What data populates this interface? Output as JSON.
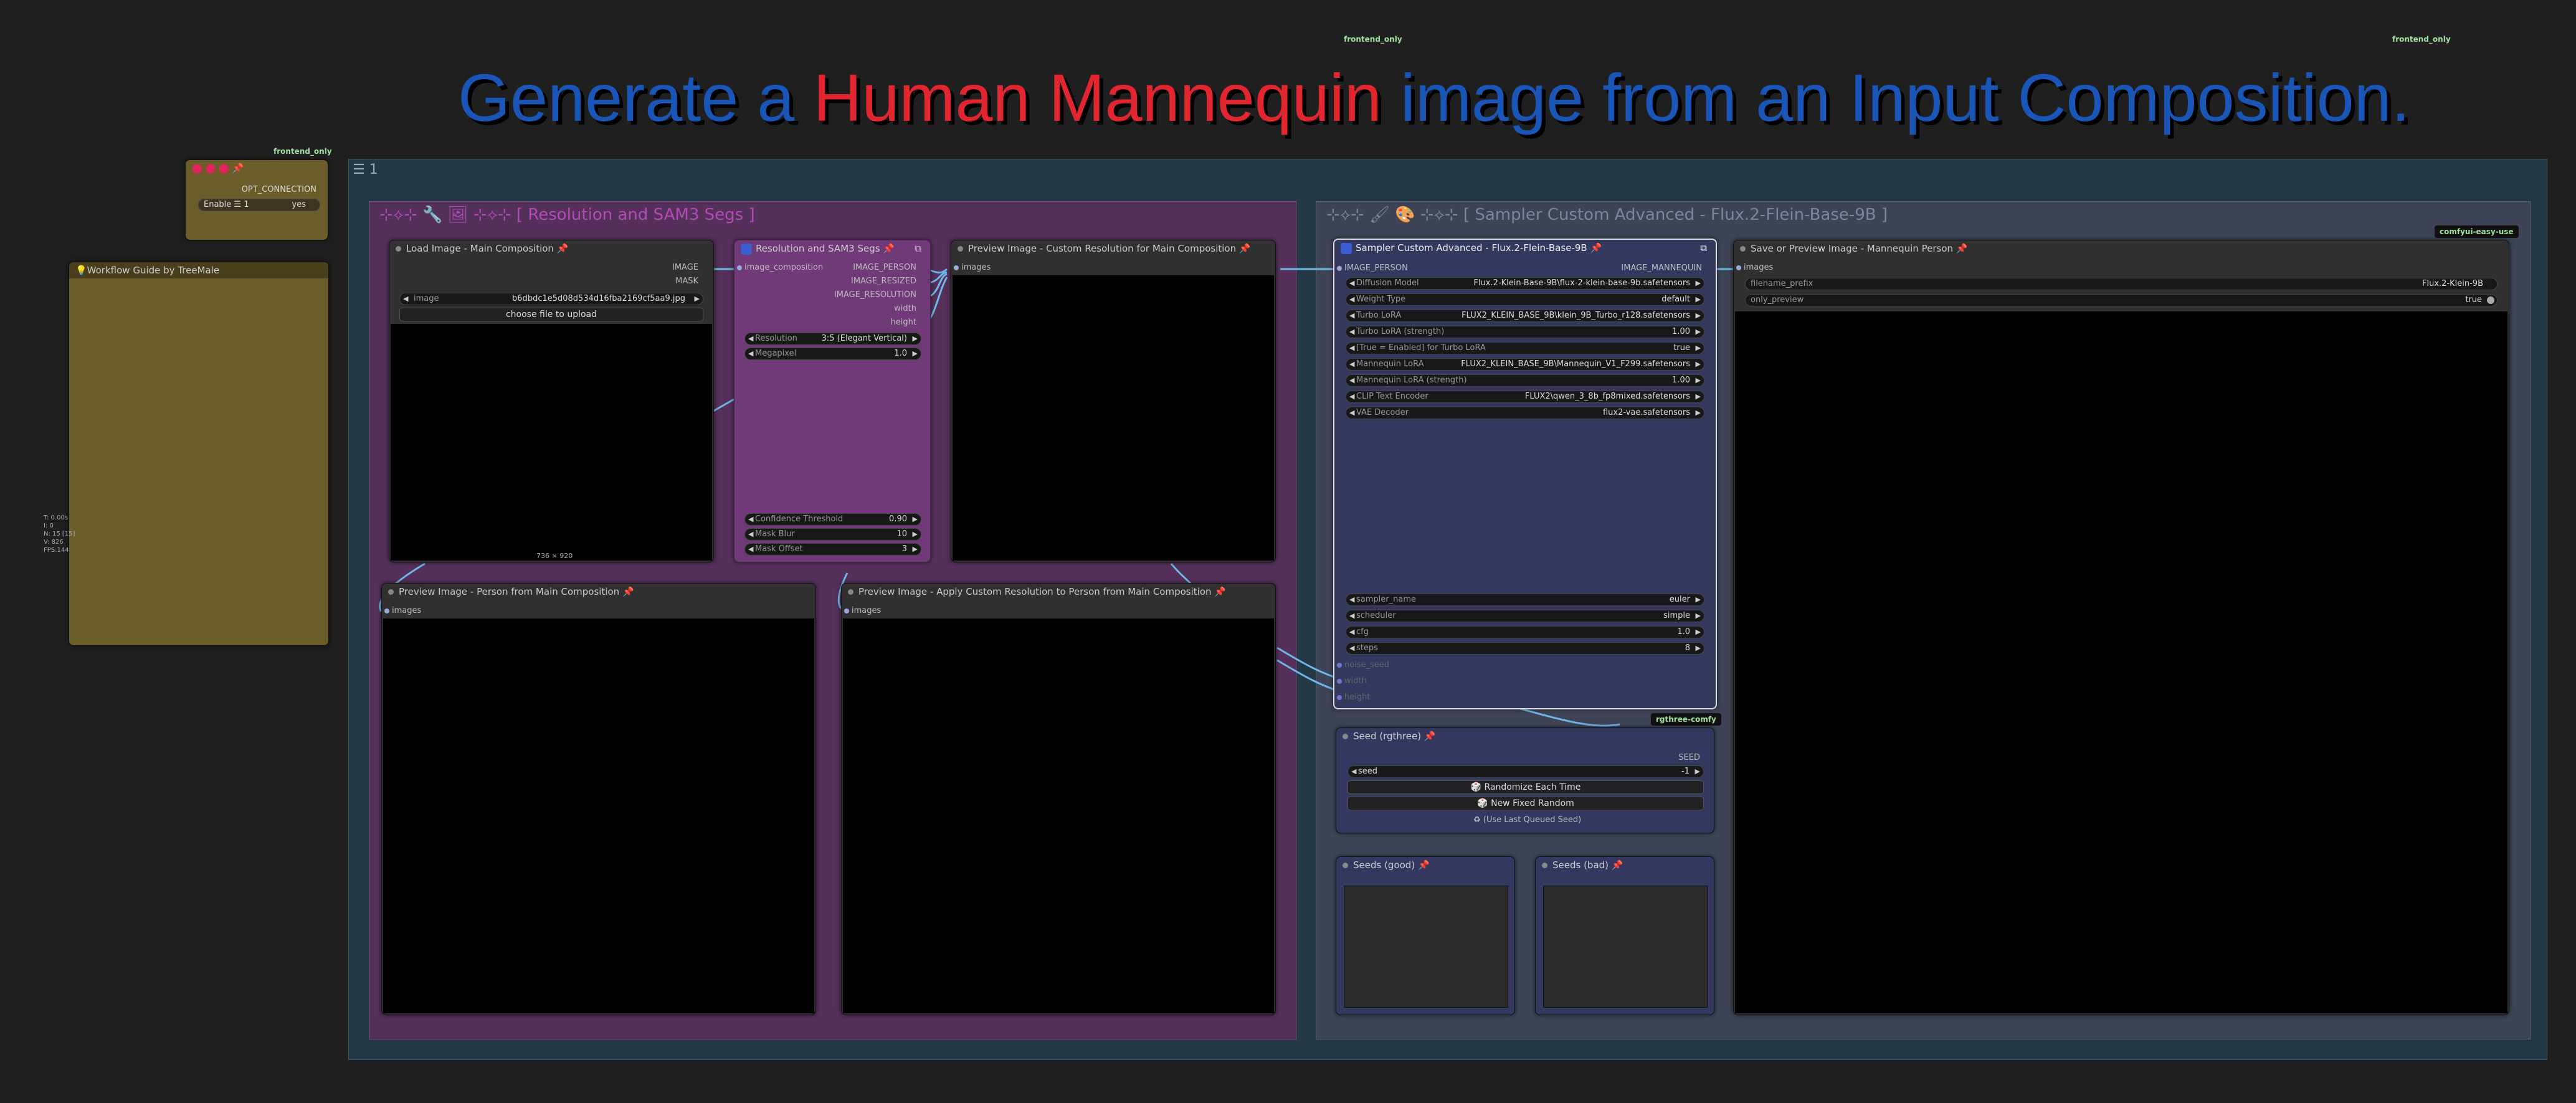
{
  "tags": {
    "top_center": "frontend_only",
    "top_right": "frontend_only",
    "left": "frontend_only",
    "rgthree": "rgthree-comfy",
    "easy_use": "comfyui-easy-use"
  },
  "heading": {
    "part1": "Generate a ",
    "part2": "Human Mannequin",
    "part3": " image from an Input Composition."
  },
  "opt_node": {
    "output": "OPT_CONNECTION",
    "widget_label": "Enable ☰ 1",
    "widget_value": "yes"
  },
  "guide_node": {
    "title": "💡Workflow Guide by TreeMale"
  },
  "left_stats": {
    "t": "T: 0.00s",
    "i": "I: 0",
    "n": "N: 15 [15]",
    "v": "V: 826",
    "fps": "FPS:144"
  },
  "outer_group": {
    "icons": "☰ 1"
  },
  "group1": {
    "title": "⊹⟡⊹ 🔧 🖼 ⊹⟡⊹ [ Resolution and SAM3 Segs ]"
  },
  "group2": {
    "title": "⊹⟡⊹ 🖌 🎨 ⊹⟡⊹ [ Sampler Custom Advanced - Flux.2-Flein-Base-9B ]"
  },
  "load_image": {
    "title": "Load Image - Main Composition",
    "out1": "IMAGE",
    "out2": "MASK",
    "image_label": "image",
    "image_value": "b6dbdc1e5d08d534d16fba2169cf5aa9.jpg",
    "upload": "choose file to upload",
    "size": "736 × 920"
  },
  "res_sam": {
    "title": "Resolution and SAM3 Segs",
    "input": "image_composition",
    "outputs": [
      "IMAGE_PERSON",
      "IMAGE_RESIZED",
      "IMAGE_RESOLUTION",
      "width",
      "height"
    ],
    "widgets": [
      {
        "label": "Resolution",
        "value": "3:5 (Elegant Vertical)"
      },
      {
        "label": "Megapixel",
        "value": "1.0"
      }
    ],
    "widgets2": [
      {
        "label": "Confidence Threshold",
        "value": "0.90"
      },
      {
        "label": "Mask Blur",
        "value": "10"
      },
      {
        "label": "Mask Offset",
        "value": "3"
      }
    ]
  },
  "preview1": {
    "title": "Preview Image - Custom Resolution for Main Composition",
    "input": "images"
  },
  "preview2": {
    "title": "Preview Image - Person from Main Composition",
    "input": "images"
  },
  "preview3": {
    "title": "Preview Image - Apply Custom Resolution to Person from Main Composition",
    "input": "images"
  },
  "sampler": {
    "title": "Sampler Custom Advanced - Flux.2-Flein-Base-9B",
    "input": "IMAGE_PERSON",
    "output": "IMAGE_MANNEQUIN",
    "widgets": [
      {
        "label": "Diffusion Model",
        "value": "Flux.2-Klein-Base-9B\\flux-2-klein-base-9b.safetensors"
      },
      {
        "label": "Weight Type",
        "value": "default"
      },
      {
        "label": "Turbo LoRA",
        "value": "FLUX2_KLEIN_BASE_9B\\klein_9B_Turbo_r128.safetensors"
      },
      {
        "label": "Turbo LoRA (strength)",
        "value": "1.00"
      },
      {
        "label": "[True = Enabled] for Turbo LoRA",
        "value": "true"
      },
      {
        "label": "Mannequin LoRA",
        "value": "FLUX2_KLEIN_BASE_9B\\Mannequin_V1_F299.safetensors"
      },
      {
        "label": "Mannequin LoRA (strength)",
        "value": "1.00"
      },
      {
        "label": "CLIP Text Encoder",
        "value": "FLUX2\\qwen_3_8b_fp8mixed.safetensors"
      },
      {
        "label": "VAE Decoder",
        "value": "flux2-vae.safetensors"
      }
    ],
    "widgets2": [
      {
        "label": "sampler_name",
        "value": "euler"
      },
      {
        "label": "scheduler",
        "value": "simple"
      },
      {
        "label": "cfg",
        "value": "1.0"
      },
      {
        "label": "steps",
        "value": "8"
      }
    ],
    "inputs2": [
      "noise_seed",
      "width",
      "height"
    ]
  },
  "seed": {
    "title": "Seed (rgthree)",
    "output": "SEED",
    "widget_label": "seed",
    "widget_value": "-1",
    "btn1": "🎲 Randomize Each Time",
    "btn2": "🎲 New Fixed Random",
    "btn3": "♻ (Use Last Queued Seed)"
  },
  "seeds_good": {
    "title": "Seeds (good)"
  },
  "seeds_bad": {
    "title": "Seeds (bad)"
  },
  "save": {
    "title": "Save or Preview Image - Mannequin Person",
    "input": "images",
    "w1_label": "filename_prefix",
    "w1_value": "Flux.2-Klein-9B",
    "w2_label": "only_preview",
    "w2_value": "true"
  }
}
